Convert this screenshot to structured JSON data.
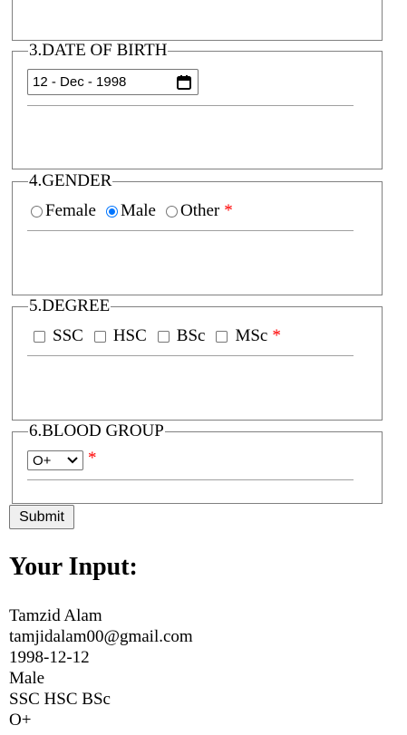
{
  "date_of_birth": {
    "legend": "3.DATE OF BIRTH",
    "value": "12 - Dec - 1998"
  },
  "gender": {
    "legend": "4.GENDER",
    "options": [
      {
        "label": "Female",
        "checked": false
      },
      {
        "label": "Male",
        "checked": true
      },
      {
        "label": "Other",
        "checked": false
      }
    ],
    "required_mark": "*"
  },
  "degree": {
    "legend": "5.DEGREE",
    "options": [
      {
        "label": "SSC",
        "checked": false
      },
      {
        "label": "HSC",
        "checked": false
      },
      {
        "label": "BSc",
        "checked": false
      },
      {
        "label": "MSc",
        "checked": false
      }
    ],
    "required_mark": "*"
  },
  "blood_group": {
    "legend": "6.BLOOD GROUP",
    "selected": "O+",
    "required_mark": "*"
  },
  "submit_label": "Submit",
  "output": {
    "heading": "Your Input:",
    "lines": [
      "Tamzid Alam",
      "tamjidalam00@gmail.com",
      "1998-12-12",
      "Male",
      "SSC HSC BSc",
      "O+"
    ]
  },
  "colors": {
    "required": "#ff0000",
    "accent": "#0075ff"
  },
  "icons": {
    "date": "calendar-icon",
    "select": "chevron-down-icon"
  }
}
